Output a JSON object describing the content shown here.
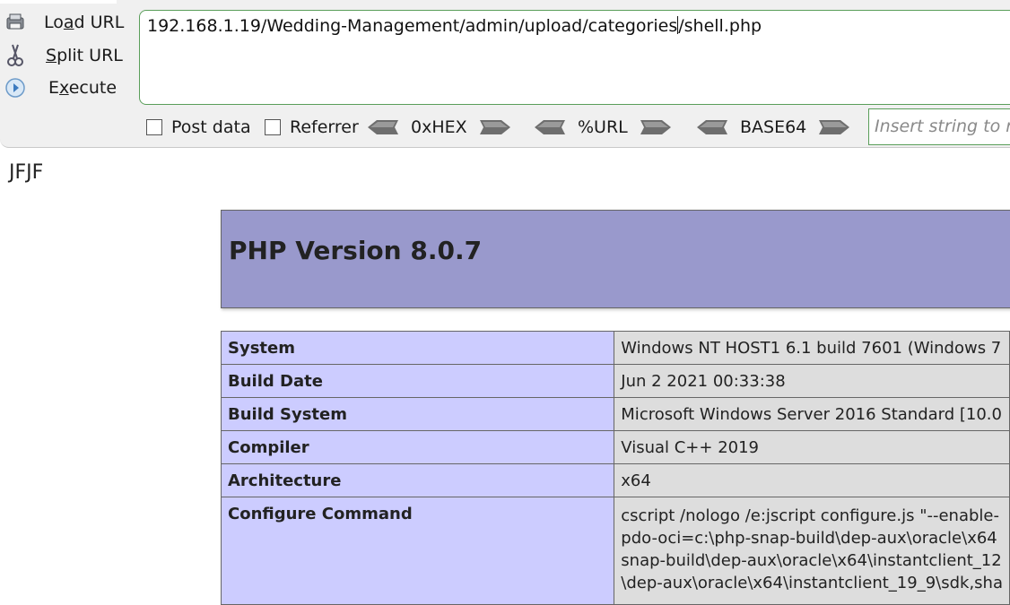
{
  "hackbar": {
    "menu": [
      {
        "label": "Load URL",
        "icon": "load-url-icon"
      },
      {
        "label": "Split URL",
        "icon": "scissors-icon"
      },
      {
        "label": "Execute",
        "icon": "play-icon"
      }
    ],
    "url_before_caret": "192.168.1.19/Wedding-Management/admin/upload/categories",
    "url_after_caret": "/shell.php",
    "options": {
      "post_data": {
        "label": "Post data",
        "checked": false
      },
      "referrer": {
        "label": "Referrer",
        "checked": false
      }
    },
    "encoders": [
      "0xHEX",
      "%URL",
      "BASE64"
    ],
    "insert_placeholder": "Insert string to replace",
    "accent_color": "#5a9e5a"
  },
  "page": {
    "text": "JFJF",
    "php_title": "PHP Version 8.0.7",
    "rows": [
      {
        "key": "System",
        "value": "Windows NT HOST1 6.1 build 7601 (Windows 7"
      },
      {
        "key": "Build Date",
        "value": "Jun 2 2021 00:33:38"
      },
      {
        "key": "Build System",
        "value": "Microsoft Windows Server 2016 Standard [10.0"
      },
      {
        "key": "Compiler",
        "value": "Visual C++ 2019"
      },
      {
        "key": "Architecture",
        "value": "x64"
      }
    ],
    "configure": {
      "key": "Configure Command",
      "lines": [
        "cscript /nologo /e:jscript configure.js \"--enable-",
        "pdo-oci=c:\\php-snap-build\\dep-aux\\oracle\\x64",
        "snap-build\\dep-aux\\oracle\\x64\\instantclient_12",
        "\\dep-aux\\oracle\\x64\\instantclient_19_9\\sdk,sha"
      ]
    },
    "colors": {
      "header_bg": "#9999cc",
      "key_bg": "#ccccff",
      "value_bg": "#dddddd"
    }
  }
}
